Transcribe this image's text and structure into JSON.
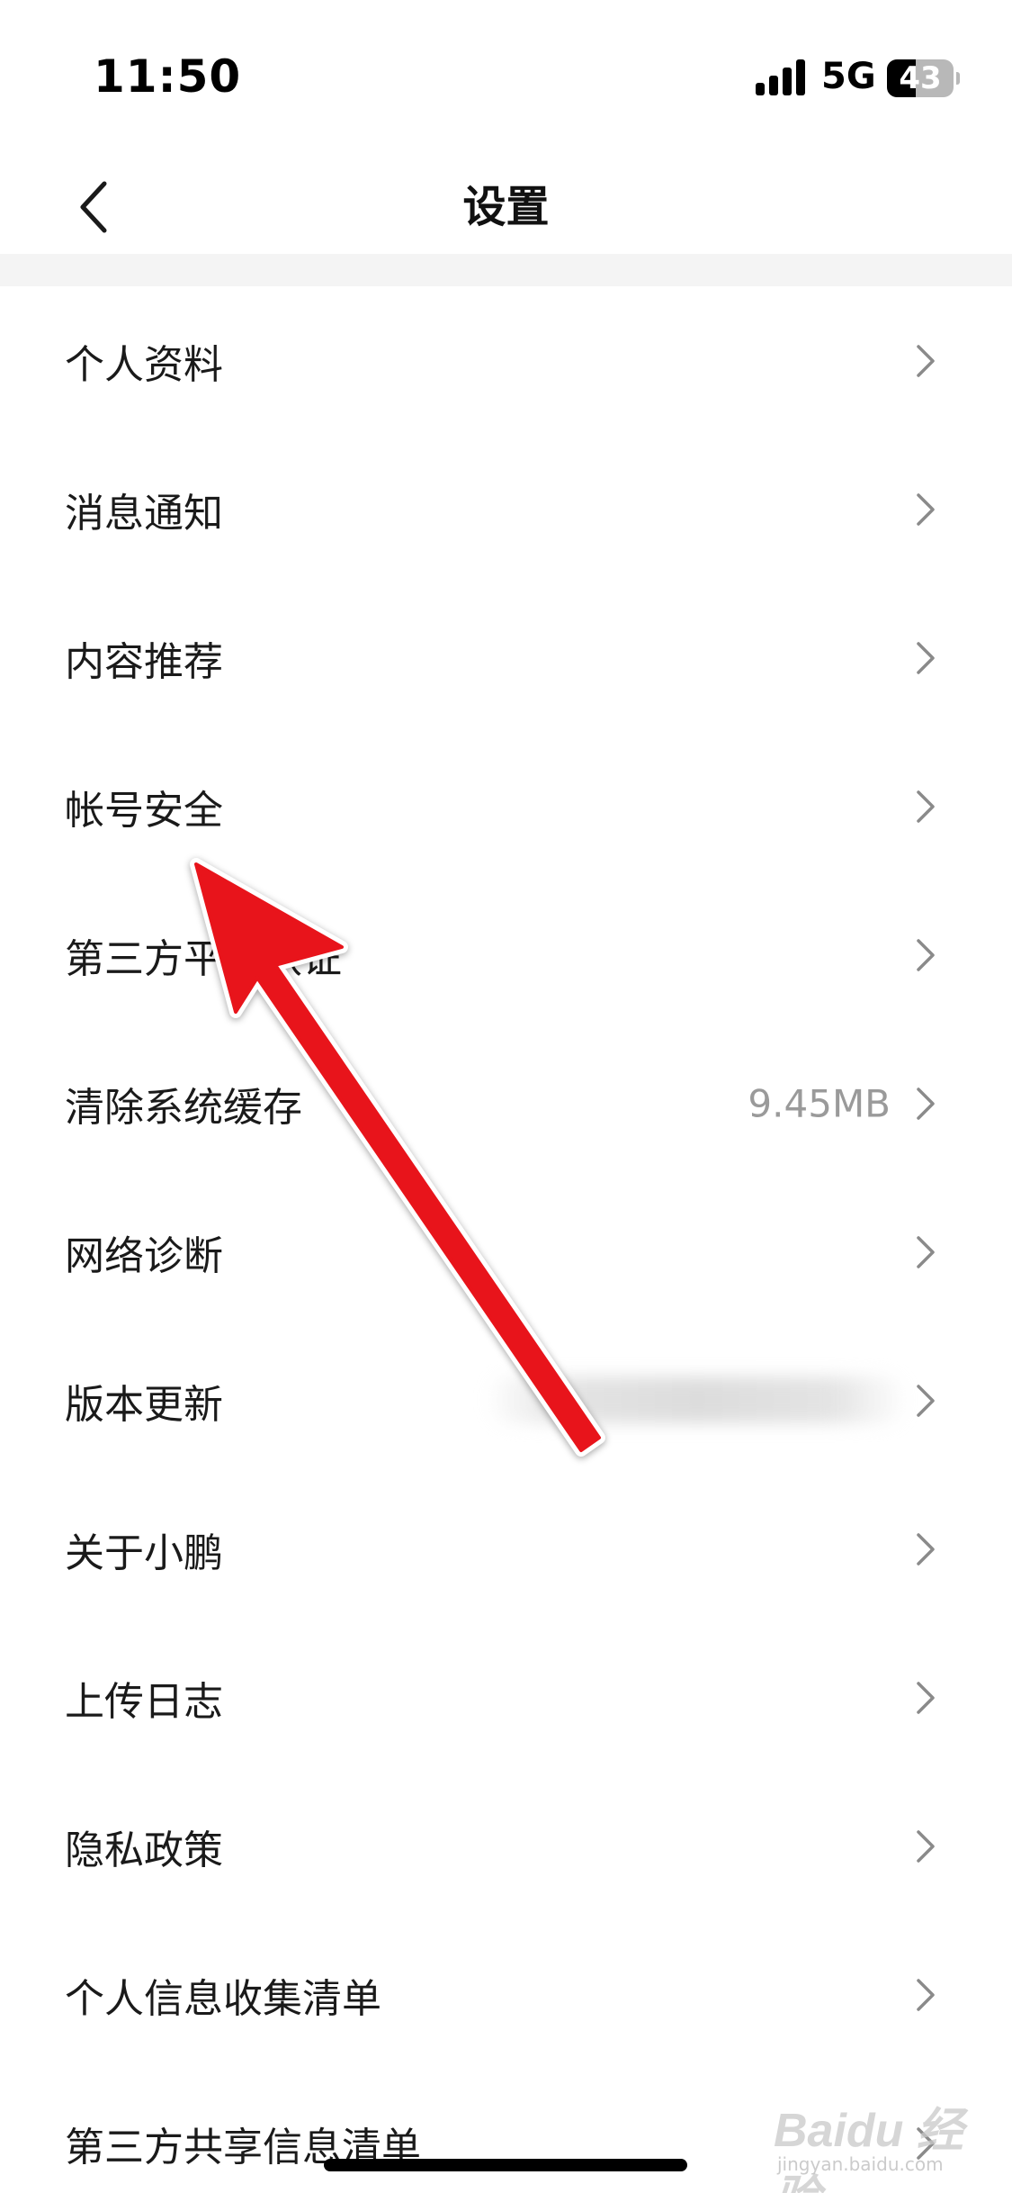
{
  "status_bar": {
    "time": "11:50",
    "network": "5G",
    "battery": "43",
    "battery_level_percent": 43
  },
  "nav": {
    "title": "设置",
    "back_icon": "chevron-left-icon"
  },
  "settings": {
    "items": [
      {
        "label": "个人资料"
      },
      {
        "label": "消息通知"
      },
      {
        "label": "内容推荐"
      },
      {
        "label": "帐号安全"
      },
      {
        "label": "第三方平台认证"
      },
      {
        "label": "清除系统缓存",
        "value": "9.45MB"
      },
      {
        "label": "网络诊断"
      },
      {
        "label": "版本更新",
        "value_obscured": true
      },
      {
        "label": "关于小鹏"
      },
      {
        "label": "上传日志"
      },
      {
        "label": "隐私政策"
      },
      {
        "label": "个人信息收集清单"
      },
      {
        "label": "第三方共享信息清单"
      }
    ]
  },
  "annotation": {
    "arrow_color": "#e8141b",
    "points_to": "帐号安全"
  },
  "watermark": {
    "main": "Baidu 经验",
    "sub": "jingyan.baidu.com"
  },
  "colors": {
    "background": "#ffffff",
    "section_gap": "#f4f4f4",
    "label": "#1a1a1a",
    "value": "#9a9a9a",
    "chevron": "#8a8a8a"
  }
}
